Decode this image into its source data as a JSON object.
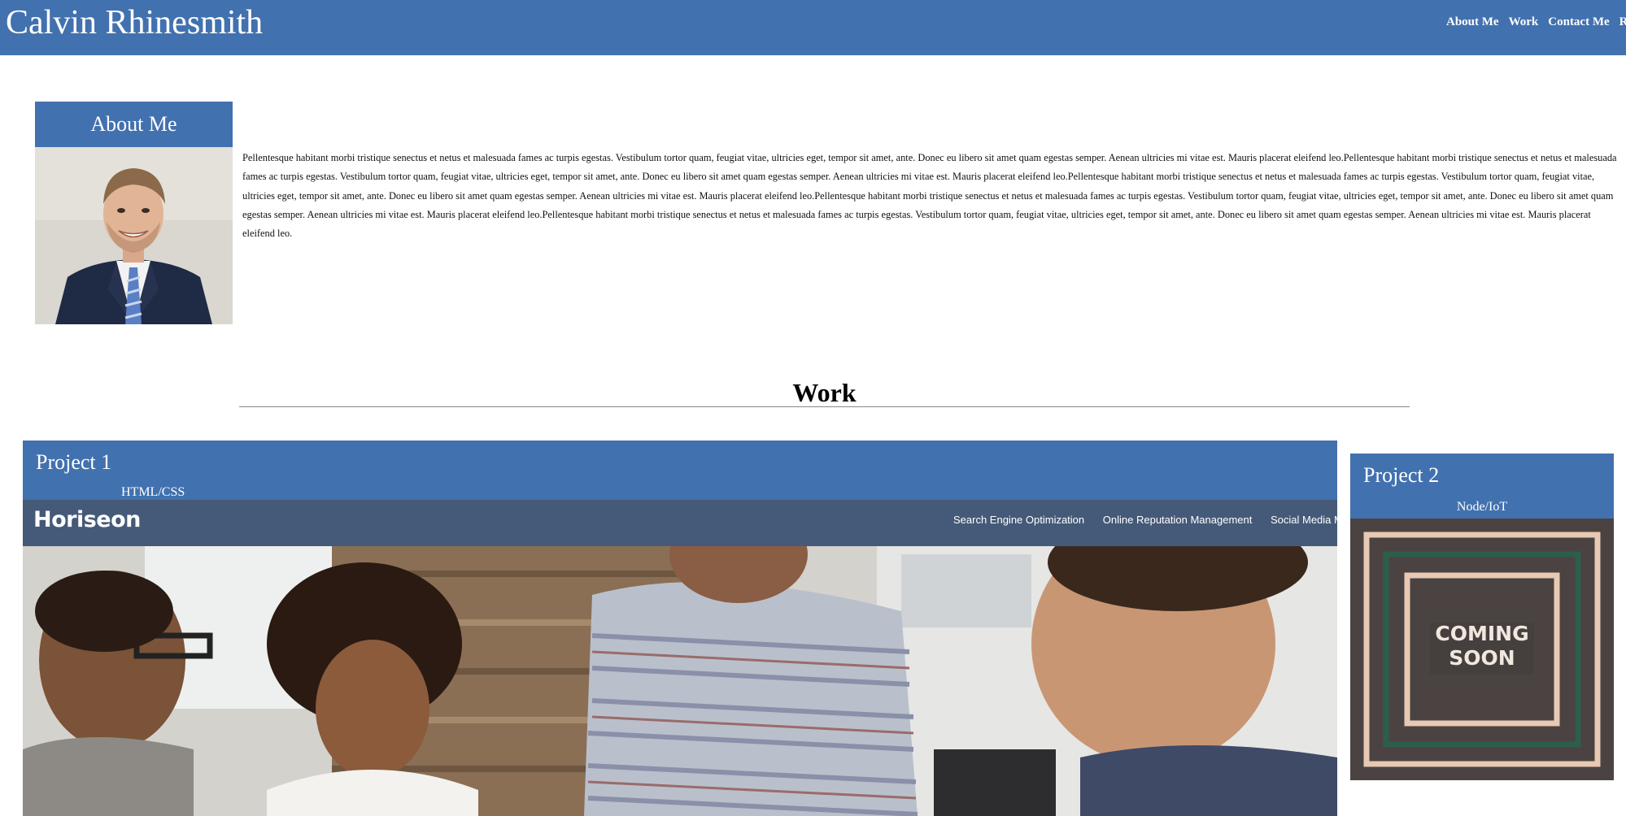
{
  "header": {
    "title": "Calvin Rhinesmith",
    "nav": [
      "About Me",
      "Work",
      "Contact Me",
      "Resume"
    ]
  },
  "about": {
    "heading": "About Me",
    "text": "Pellentesque habitant morbi tristique senectus et netus et malesuada fames ac turpis egestas. Vestibulum tortor quam, feugiat vitae, ultricies eget, tempor sit amet, ante. Donec eu libero sit amet quam egestas semper. Aenean ultricies mi vitae est. Mauris placerat eleifend leo.Pellentesque habitant morbi tristique senectus et netus et malesuada fames ac turpis egestas. Vestibulum tortor quam, feugiat vitae, ultricies eget, tempor sit amet, ante. Donec eu libero sit amet quam egestas semper. Aenean ultricies mi vitae est. Mauris placerat eleifend leo.Pellentesque habitant morbi tristique senectus et netus et malesuada fames ac turpis egestas. Vestibulum tortor quam, feugiat vitae, ultricies eget, tempor sit amet, ante. Donec eu libero sit amet quam egestas semper. Aenean ultricies mi vitae est. Mauris placerat eleifend leo.Pellentesque habitant morbi tristique senectus et netus et malesuada fames ac turpis egestas. Vestibulum tortor quam, feugiat vitae, ultricies eget, tempor sit amet, ante. Donec eu libero sit amet quam egestas semper. Aenean ultricies mi vitae est. Mauris placerat eleifend leo.Pellentesque habitant morbi tristique senectus et netus et malesuada fames ac turpis egestas. Vestibulum tortor quam, feugiat vitae, ultricies eget, tempor sit amet, ante. Donec eu libero sit amet quam egestas semper. Aenean ultricies mi vitae est. Mauris placerat eleifend leo."
  },
  "work": {
    "heading": "Work",
    "projects": [
      {
        "title": "Project 1",
        "tech": "HTML/CSS",
        "screenshot": {
          "logo": "Horiseon",
          "nav": [
            "Search Engine Optimization",
            "Online Reputation Management",
            "Social Media Marketing"
          ]
        }
      },
      {
        "title": "Project 2",
        "tech": "Node/IoT",
        "image_text": [
          "COMING",
          "SOON"
        ]
      }
    ]
  },
  "colors": {
    "brand_blue": "#4271af",
    "horiseon_header": "#455a78",
    "coming_soon_bg": "#4a4341",
    "coming_soon_tan": "#e8c9b3",
    "coming_soon_green": "#2c5e4c"
  }
}
